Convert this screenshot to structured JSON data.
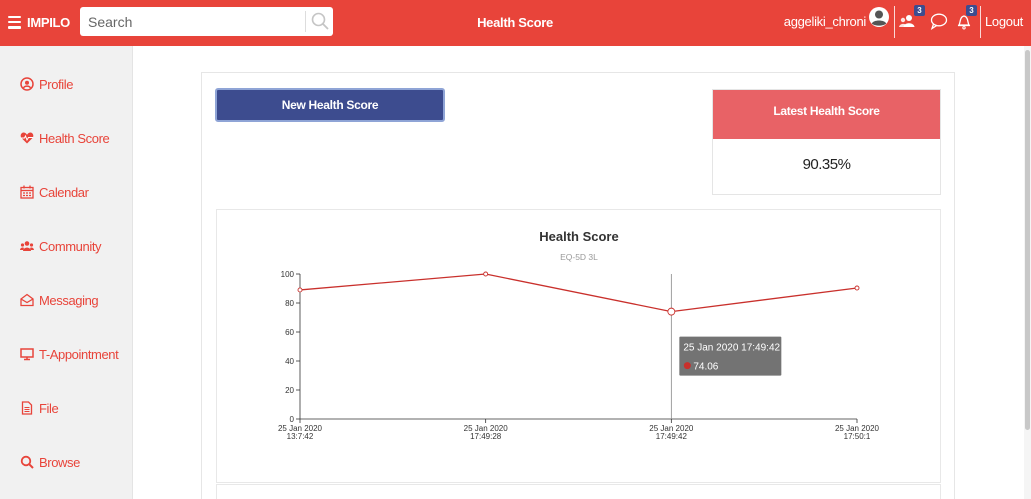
{
  "topbar": {
    "brand": "IMPILO",
    "search_placeholder": "Search",
    "title": "Health Score",
    "username": "aggeliki_chroni",
    "community_badge": "3",
    "notification_badge": "3",
    "logout": "Logout"
  },
  "sidebar": {
    "items": [
      {
        "label": "Profile",
        "icon": "user-circle-icon"
      },
      {
        "label": "Health Score",
        "icon": "heartbeat-icon"
      },
      {
        "label": "Calendar",
        "icon": "calendar-icon"
      },
      {
        "label": "Community",
        "icon": "users-icon"
      },
      {
        "label": "Messaging",
        "icon": "envelope-icon"
      },
      {
        "label": "T-Appointment",
        "icon": "monitor-icon"
      },
      {
        "label": "File",
        "icon": "file-icon"
      },
      {
        "label": "Browse",
        "icon": "search-icon"
      }
    ]
  },
  "main": {
    "new_button": "New Health Score",
    "latest_title": "Latest Health Score",
    "latest_value": "90.35%"
  },
  "colors": {
    "accent": "#e8443a",
    "primary_button": "#3d4c8f",
    "latest_header": "#e86266",
    "series_line": "#c9302c"
  },
  "chart_data": {
    "type": "line",
    "title": "Health Score",
    "subtitle": "EQ-5D 3L",
    "x": [
      "25 Jan 2020\n13:7:42",
      "25 Jan 2020\n17:49:28",
      "25 Jan 2020\n17:49:42",
      "25 Jan 2020\n17:50:1"
    ],
    "series": [
      {
        "values": [
          89,
          100,
          74.06,
          90.35
        ]
      }
    ],
    "yticks": [
      0,
      20,
      40,
      60,
      80,
      100
    ],
    "ylim": [
      0,
      100
    ],
    "grid": false,
    "tooltip": {
      "title": "25 Jan 2020 17:49:42",
      "value": "74.06",
      "point_index": 2
    }
  }
}
